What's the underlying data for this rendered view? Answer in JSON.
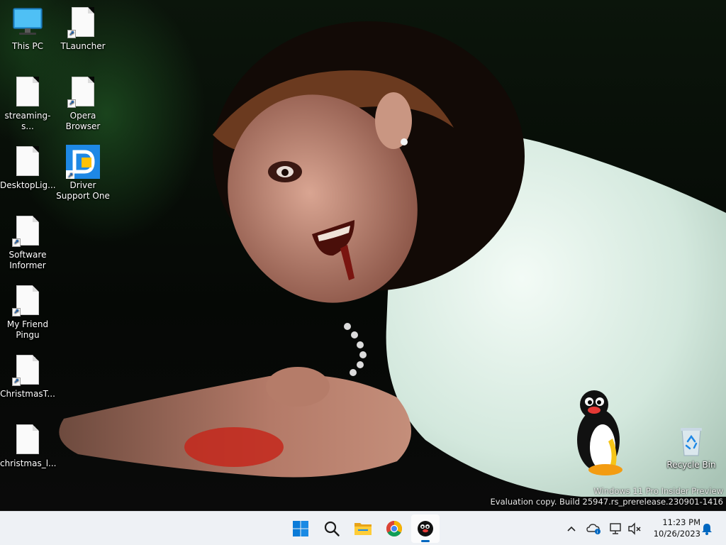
{
  "desktop": {
    "icons": [
      {
        "label": "This PC",
        "icon": "computer-icon"
      },
      {
        "label": "TLauncher",
        "icon": "file-shortcut-icon"
      },
      {
        "label": "streaming-s...",
        "icon": "file-icon"
      },
      {
        "label": "Opera Browser",
        "icon": "file-shortcut-icon"
      },
      {
        "label": "DesktopLig...",
        "icon": "file-icon"
      },
      {
        "label": "Driver Support One",
        "icon": "driver-support-icon"
      },
      {
        "label": "Software Informer",
        "icon": "file-shortcut-icon"
      },
      {
        "label": "My Friend Pingu",
        "icon": "file-shortcut-icon"
      },
      {
        "label": "ChristmasT...",
        "icon": "file-shortcut-icon"
      },
      {
        "label": "christmas_l...",
        "icon": "file-icon"
      },
      {
        "label": "Recycle Bin",
        "icon": "recycle-bin-icon"
      }
    ],
    "watermark": {
      "line1": "Windows 11 Pro Insider Preview",
      "line2": "Evaluation copy. Build 25947.rs_prerelease.230901-1416"
    }
  },
  "taskbar": {
    "apps": [
      {
        "name": "Start",
        "icon": "windows-start-icon",
        "active": false
      },
      {
        "name": "Search",
        "icon": "search-icon",
        "active": false
      },
      {
        "name": "File Explorer",
        "icon": "folder-icon",
        "active": false
      },
      {
        "name": "Google Chrome",
        "icon": "chrome-icon",
        "active": false
      },
      {
        "name": "Pingu",
        "icon": "pingu-app-icon",
        "active": true
      }
    ],
    "tray": {
      "time": "11:23 PM",
      "date": "10/26/2023",
      "icons": [
        "chevron-up-icon",
        "onedrive-icon",
        "network-icon",
        "volume-muted-icon",
        "notification-bell-icon"
      ]
    }
  },
  "colors": {
    "taskbar_bg": "#eef1f5",
    "accent": "#0067c0"
  }
}
